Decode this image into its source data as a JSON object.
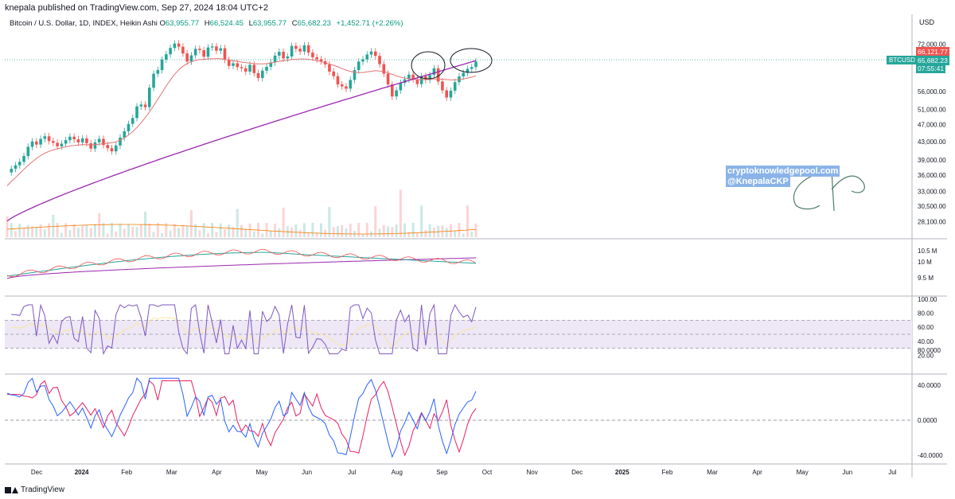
{
  "header": {
    "publisher": "knepala published on TradingView.com, Sep 27, 2024 18:04 UTC+2",
    "symbol_desc": "Bitcoin / U.S. Dollar, 1D, INDEX, Heikin Ashi",
    "o_label": "O",
    "o_value": "63,955.77",
    "h_label": "H",
    "h_value": "66,524.45",
    "l_label": "L",
    "l_value": "63,955.77",
    "c_label": "C",
    "c_value": "65,682.23",
    "change": "+1,452.71 (+2.26%)"
  },
  "currency": "USD",
  "price_tags": {
    "red_value": "66,121.77",
    "last_value": "65,682.23",
    "countdown": "07:55:41",
    "symbol": "BTCUSD"
  },
  "watermark": {
    "line1": "cryptoknowledgepool.com",
    "line2": "@KnepalaCKP"
  },
  "footer": {
    "brand": "TradingView"
  },
  "colors": {
    "up": "#26a69a",
    "down": "#ef5350",
    "ma_long": "#9c27b0",
    "ma_short": "#e57373",
    "rsi_band": "#ede7f6",
    "signal_blue": "#2962ff"
  },
  "chart_data": {
    "type": "candlestick",
    "price_axis_ticks": [
      "72,000.00",
      "56,000.00",
      "51,000.00",
      "47,000.00",
      "43,000.00",
      "39,000.00",
      "36,000.00",
      "33,000.00",
      "30,500.00",
      "28,100.00"
    ],
    "volume_axis_ticks": [
      "10.5 M",
      "10 M",
      "9.5 M"
    ],
    "rsi_axis_ticks": [
      "100.00",
      "80.00",
      "60.00",
      "40.00",
      "20.00"
    ],
    "osc_axis_ticks": [
      "80.0000",
      "40.0000",
      "0.0000",
      "-40.0000"
    ],
    "x_ticks": [
      "Dec",
      "2024",
      "Feb",
      "Mar",
      "Apr",
      "May",
      "Jun",
      "Jul",
      "Aug",
      "Sep",
      "Oct",
      "Nov",
      "Dec",
      "2025",
      "Feb",
      "Mar",
      "Apr",
      "May",
      "Jun",
      "Jul"
    ],
    "price_path": [
      36500,
      37200,
      37900,
      38600,
      39800,
      41800,
      43000,
      42300,
      43600,
      44200,
      43100,
      42700,
      41900,
      42500,
      43300,
      44100,
      43500,
      42800,
      43700,
      42600,
      41400,
      42800,
      43600,
      42200,
      41500,
      40800,
      42100,
      43900,
      45400,
      47200,
      48700,
      51800,
      52300,
      51600,
      57200,
      61600,
      62800,
      66400,
      68300,
      70600,
      72300,
      71100,
      68600,
      65700,
      67900,
      70300,
      69800,
      67400,
      70800,
      71200,
      69600,
      70500,
      66300,
      64200,
      65100,
      63800,
      63400,
      62300,
      64600,
      61800,
      60200,
      62600,
      63900,
      65400,
      67800,
      69200,
      66800,
      67500,
      71400,
      70300,
      69300,
      71600,
      68900,
      67200,
      66500,
      65800,
      64700,
      62300,
      60800,
      58200,
      57600,
      56900,
      59600,
      62800,
      65700,
      66500,
      68200,
      69300,
      67700,
      64800,
      61600,
      58200,
      54600,
      56400,
      58700,
      59800,
      61300,
      59800,
      58300,
      60800,
      59600,
      61200,
      63400,
      59100,
      56400,
      54300,
      56300,
      58900,
      60700,
      61900,
      63200,
      63800,
      65700
    ],
    "ma_short_path": [
      34000,
      34800,
      35500,
      36300,
      37100,
      37900,
      38600,
      39300,
      39900,
      40400,
      40800,
      41100,
      41400,
      41600,
      41800,
      42000,
      42100,
      42200,
      42300,
      42300,
      42300,
      42300,
      42400,
      42500,
      42600,
      42700,
      42900,
      43300,
      43800,
      44500,
      45300,
      46300,
      47500,
      48800,
      50300,
      52000,
      53800,
      55700,
      57700,
      59600,
      61400,
      62900,
      64100,
      65000,
      65600,
      66100,
      66400,
      66500,
      66600,
      66700,
      66700,
      66700,
      66500,
      66300,
      66000,
      65800,
      65500,
      65300,
      65200,
      65000,
      64900,
      64900,
      65000,
      65200,
      65500,
      65800,
      66000,
      66200,
      66400,
      66500,
      66600,
      66600,
      66500,
      66300,
      66000,
      65700,
      65300,
      64900,
      64400,
      63900,
      63300,
      62800,
      62400,
      62100,
      62000,
      62000,
      62200,
      62400,
      62600,
      62500,
      62300,
      61900,
      61400,
      60900,
      60500,
      60200,
      60000,
      59800,
      59700,
      59700,
      59700,
      59800,
      59900,
      59900,
      59800,
      59700,
      59600,
      59600,
      59700,
      59900,
      60200,
      60500,
      60900
    ]
  }
}
